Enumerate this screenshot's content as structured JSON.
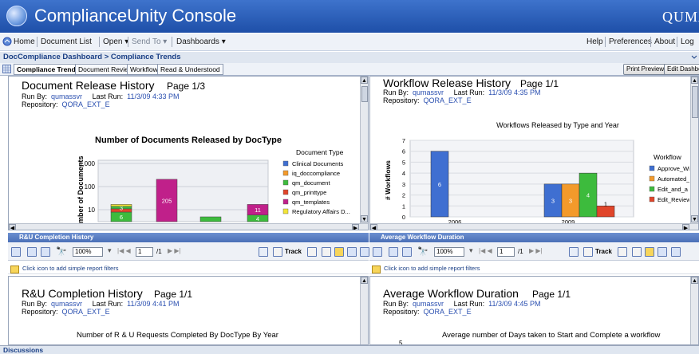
{
  "app": {
    "title": "ComplianceUnity Console",
    "brand": "QUMAS"
  },
  "menu": {
    "home": "Home",
    "document_list": "Document List",
    "open": "Open ▾",
    "send_to": "Send To ▾",
    "dashboards": "Dashboards ▾",
    "help": "Help",
    "preferences": "Preferences",
    "about": "About",
    "log": "Log"
  },
  "breadcrumb": "DocCompliance Dashboard > Compliance Trends",
  "tabs": [
    "Compliance Trends",
    "Document Review",
    "Workflow",
    "Read & Understood"
  ],
  "buttons": {
    "print_preview": "Print Preview",
    "edit_dashboard": "Edit Dashbo"
  },
  "reports": {
    "doc_release": {
      "title": "Document Release History",
      "page": "Page  1/3",
      "run_by_label": "Run By:",
      "run_by": "qumassvr",
      "last_run_label": "Last Run:",
      "last_run": "11/3/09 4:33 PM",
      "repo_label": "Repository:",
      "repo": "QORA_EXT_E"
    },
    "wf_release": {
      "title": "Workflow Release History",
      "page": "Page  1/1",
      "run_by_label": "Run By:",
      "run_by": "qumassvr",
      "last_run_label": "Last Run:",
      "last_run": "11/3/09 4:35 PM",
      "repo_label": "Repository:",
      "repo": "QORA_EXT_E"
    },
    "ru": {
      "section": "R&U Completion History",
      "title": "R&U Completion History",
      "page": "Page  1/1",
      "run_by_label": "Run By:",
      "run_by": "qumassvr",
      "last_run_label": "Last Run:",
      "last_run": "11/3/09 4:41 PM",
      "repo_label": "Repository:",
      "repo": "QORA_EXT_E",
      "subtitle": "Number of R & U Requests Completed By DocType By Year"
    },
    "avg": {
      "section": "Average Workflow Duration",
      "title": "Average Workflow Duration",
      "page": "Page  1/1",
      "run_by_label": "Run By:",
      "run_by": "qumassvr",
      "last_run_label": "Last Run:",
      "last_run": "11/3/09 4:45 PM",
      "repo_label": "Repository:",
      "repo": "QORA_EXT_E",
      "subtitle": "Average number of Days taken to Start and Complete a workflow",
      "first_tick": "5"
    }
  },
  "toolbar": {
    "zoom": "100%",
    "page_input": "1",
    "page_total": "/1",
    "track": "Track",
    "filter_hint": "Click icon to add simple report filters"
  },
  "footer": {
    "discussions": "Discussions"
  },
  "chart_data": [
    {
      "type": "bar",
      "title": "Number of Documents Released by DocType",
      "ylabel": "mber of Documents",
      "yscale": "log",
      "yticks": [
        "1,000",
        "100",
        "10"
      ],
      "legend_title": "Document Type",
      "legend_position": "right",
      "stacked": true,
      "series": [
        {
          "name": "Clinical Documents",
          "color": "#3f6fd1"
        },
        {
          "name": "iq_doccompliance",
          "color": "#f39a2b"
        },
        {
          "name": "qm_document",
          "color": "#3dbb3d"
        },
        {
          "name": "qm_printtype",
          "color": "#e0452a"
        },
        {
          "name": "qm_templates",
          "color": "#c0208a"
        },
        {
          "name": "Regulatory Affairs D...",
          "color": "#f2e436"
        }
      ],
      "bars": [
        {
          "segments": [
            {
              "color": "#f39a2b",
              "v": 1
            },
            {
              "color": "#3dbb3d",
              "v": 6,
              "label": "6"
            },
            {
              "color": "#e0452a",
              "v": 3
            },
            {
              "color": "#3dbb3d",
              "v": 3,
              "label": "3"
            },
            {
              "color": "#f2e436",
              "v": 3
            }
          ]
        },
        {
          "segments": [
            {
              "color": "#c0208a",
              "v": 205,
              "label": "205"
            }
          ]
        },
        {
          "segments": [
            {
              "color": "#3dbb3d",
              "v": 4
            }
          ]
        },
        {
          "segments": [
            {
              "color": "#3dbb3d",
              "v": 1
            },
            {
              "color": "#3dbb3d",
              "v": 4,
              "label": "4"
            },
            {
              "color": "#c0208a",
              "v": 11,
              "label": "11"
            }
          ]
        }
      ]
    },
    {
      "type": "bar",
      "title": "Workflows Released by Type and Year",
      "ylabel": "# Workflows",
      "ylim": [
        0,
        7
      ],
      "categories": [
        "2006",
        "2009"
      ],
      "legend_title": "Workflow",
      "legend_position": "right",
      "series": [
        {
          "name": "Approve_Wi",
          "color": "#3f6fd1",
          "values": [
            6,
            3
          ]
        },
        {
          "name": "Automated_",
          "color": "#f39a2b",
          "values": [
            0,
            3
          ]
        },
        {
          "name": "Edit_and_a",
          "color": "#3dbb3d",
          "values": [
            0,
            4
          ]
        },
        {
          "name": "Edit_Review",
          "color": "#e0452a",
          "values": [
            0,
            1
          ]
        }
      ]
    }
  ]
}
